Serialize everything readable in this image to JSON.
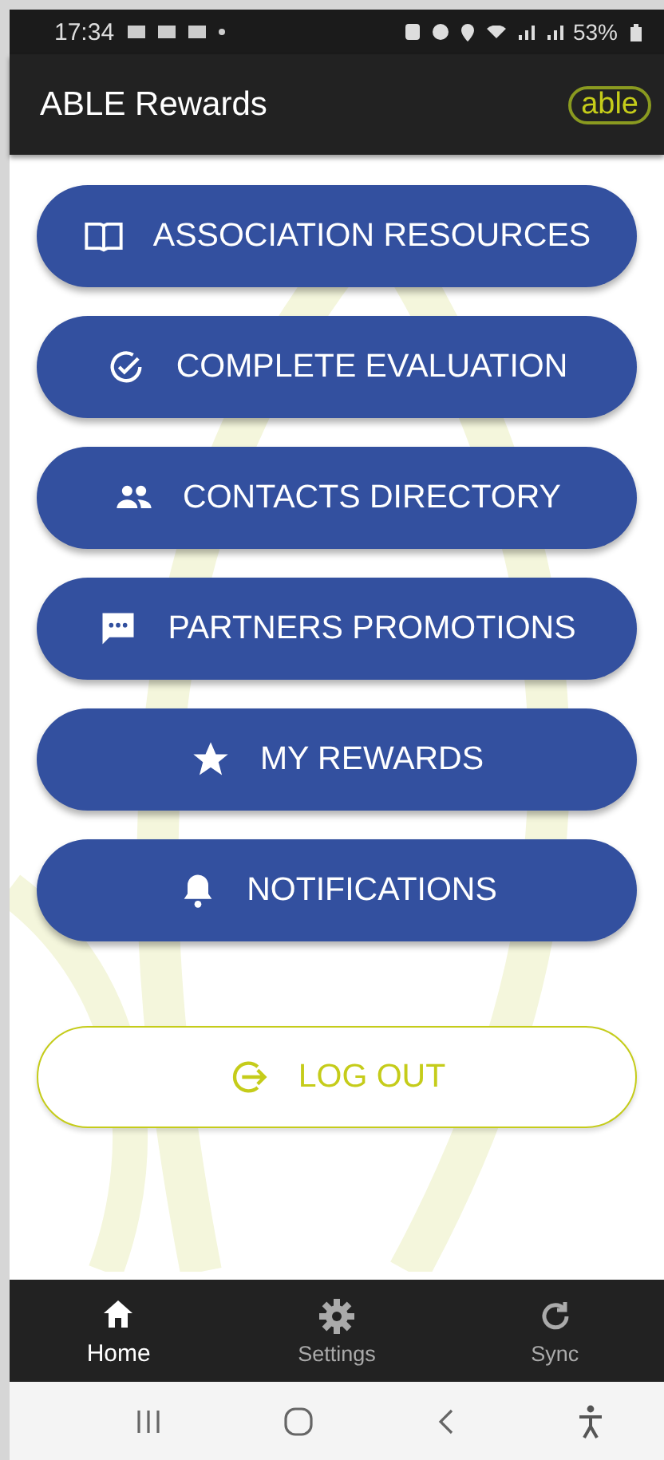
{
  "status_bar": {
    "time": "17:34",
    "battery": "53%"
  },
  "app_bar": {
    "title": "ABLE Rewards",
    "logo": "able"
  },
  "menu": [
    {
      "label": "ASSOCIATION RESOURCES",
      "kind": "book"
    },
    {
      "label": "COMPLETE EVALUATION",
      "kind": "check"
    },
    {
      "label": "CONTACTS DIRECTORY",
      "kind": "people"
    },
    {
      "label": "PARTNERS PROMOTIONS",
      "kind": "chat"
    },
    {
      "label": "MY REWARDS",
      "kind": "star"
    },
    {
      "label": "NOTIFICATIONS",
      "kind": "bell"
    }
  ],
  "logout": {
    "label": "LOG OUT"
  },
  "bottom_nav": [
    {
      "label": "Home",
      "kind": "home",
      "selected": true
    },
    {
      "label": "Settings",
      "kind": "gear",
      "selected": false
    },
    {
      "label": "Sync",
      "kind": "sync",
      "selected": false
    }
  ]
}
